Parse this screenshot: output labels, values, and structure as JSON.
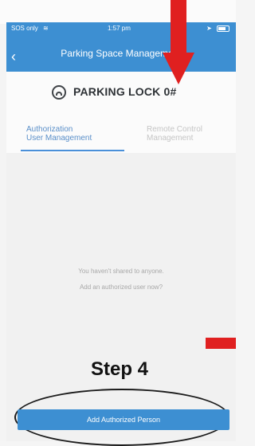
{
  "statusbar": {
    "carrier": "SOS only",
    "time": "1:57 pm"
  },
  "header": {
    "title": "Parking Space Management"
  },
  "lock": {
    "name": "PARKING LOCK 0#"
  },
  "tabs": [
    {
      "line1": "Authorization",
      "line2": "User Management",
      "active": true
    },
    {
      "line1": "Remote Control",
      "line2": "Management",
      "active": false
    }
  ],
  "empty_state": {
    "line1": "You haven't shared to anyone.",
    "line2": "Add an authorized user now?"
  },
  "annotation": {
    "step": "Step 4"
  },
  "cta": {
    "label": "Add Authorized Person"
  },
  "colors": {
    "brand": "#3d8fd2",
    "annotation_red": "#e02020"
  }
}
